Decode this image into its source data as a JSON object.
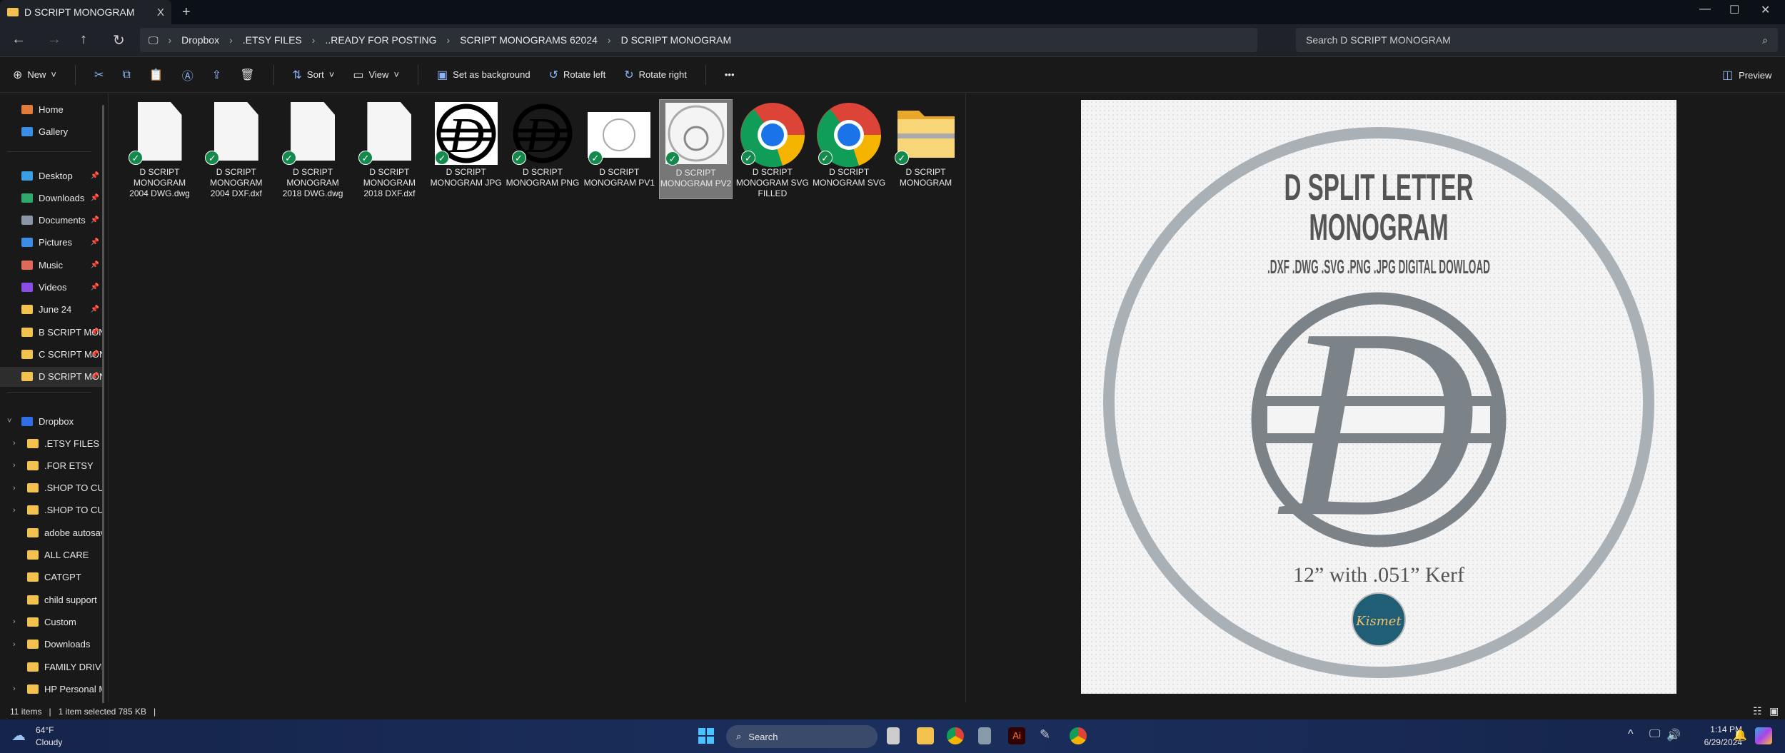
{
  "window": {
    "tab_title": "D SCRIPT MONOGRAM",
    "close": "X",
    "new_tab": "+",
    "minimize": "—",
    "maximize": "☐",
    "close_window": "✕"
  },
  "address": {
    "breadcrumbs": [
      "Dropbox",
      ".ETSY FILES",
      "..READY FOR POSTING",
      "SCRIPT MONOGRAMS 62024",
      "D SCRIPT MONOGRAM"
    ],
    "search_placeholder": "Search D SCRIPT MONOGRAM"
  },
  "toolbar": {
    "new": "New",
    "sort": "Sort",
    "view": "View",
    "set_background": "Set as background",
    "rotate_left": "Rotate left",
    "rotate_right": "Rotate right",
    "more": "•••",
    "preview": "Preview"
  },
  "sidebar": {
    "top": [
      {
        "label": "Home",
        "color": "#e07b39"
      },
      {
        "label": "Gallery",
        "color": "#3a8ee6"
      }
    ],
    "quick": [
      {
        "label": "Desktop",
        "color": "#3aa0e6"
      },
      {
        "label": "Downloads",
        "color": "#2eaa6a"
      },
      {
        "label": "Documents",
        "color": "#8a96a8"
      },
      {
        "label": "Pictures",
        "color": "#3a8ee6"
      },
      {
        "label": "Music",
        "color": "#e06a5a"
      },
      {
        "label": "Videos",
        "color": "#8a4ee6"
      },
      {
        "label": "June 24",
        "color": "#f2c14e"
      },
      {
        "label": "B SCRIPT MONOGRAM",
        "color": "#f2c14e"
      },
      {
        "label": "C SCRIPT MONOGRAM",
        "color": "#f2c14e"
      },
      {
        "label": "D SCRIPT MONOGRAM",
        "color": "#f2c14e"
      }
    ],
    "dropbox_label": "Dropbox",
    "dropbox": [
      {
        "label": ".ETSY FILES",
        "exp": true
      },
      {
        "label": ".FOR ETSY",
        "exp": true
      },
      {
        "label": ".SHOP TO CUT",
        "exp": true
      },
      {
        "label": ".SHOP TO CUT",
        "exp": true
      },
      {
        "label": "adobe autosave",
        "exp": false
      },
      {
        "label": "ALL CARE",
        "exp": false
      },
      {
        "label": "CATGPT",
        "exp": false
      },
      {
        "label": "child support",
        "exp": false
      },
      {
        "label": "Custom",
        "exp": true
      },
      {
        "label": "Downloads",
        "exp": true
      },
      {
        "label": "FAMILY DRIVE",
        "exp": false
      },
      {
        "label": "HP Personal M",
        "exp": true
      }
    ]
  },
  "files": [
    {
      "name": "D SCRIPT MONOGRAM 2004 DWG.dwg",
      "kind": "doc"
    },
    {
      "name": "D SCRIPT MONOGRAM 2004 DXF.dxf",
      "kind": "doc"
    },
    {
      "name": "D SCRIPT MONOGRAM 2018 DWG.dwg",
      "kind": "doc"
    },
    {
      "name": "D SCRIPT MONOGRAM 2018 DXF.dxf",
      "kind": "doc"
    },
    {
      "name": "D SCRIPT MONOGRAM JPG",
      "kind": "jpg"
    },
    {
      "name": "D SCRIPT MONOGRAM PNG",
      "kind": "png"
    },
    {
      "name": "D SCRIPT MONOGRAM PV1",
      "kind": "pv"
    },
    {
      "name": "D SCRIPT MONOGRAM PV2",
      "kind": "pv2",
      "selected": true
    },
    {
      "name": "D SCRIPT MONOGRAM SVG FILLED",
      "kind": "chrome"
    },
    {
      "name": "D SCRIPT MONOGRAM SVG",
      "kind": "chrome"
    },
    {
      "name": "D SCRIPT MONOGRAM",
      "kind": "zip"
    }
  ],
  "preview": {
    "title1": "D SPLIT LETTER",
    "title2": "MONOGRAM",
    "formats": ".DXF .DWG .SVG .PNG .JPG DIGITAL DOWLOAD",
    "size": "12” with .051” Kerf",
    "logo": "Kismet"
  },
  "status": {
    "items": "11 items",
    "selected": "1 item selected  785 KB"
  },
  "taskbar": {
    "temp": "64°F",
    "weather": "Cloudy",
    "search": "Search",
    "time": "1:14 PM",
    "date": "6/29/2024"
  }
}
